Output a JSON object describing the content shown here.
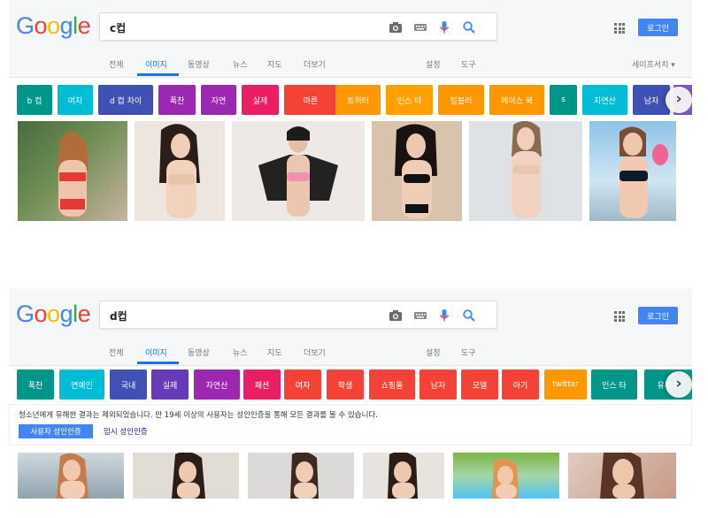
{
  "panels": [
    {
      "logo": [
        "G",
        "o",
        "o",
        "g",
        "l",
        "e"
      ],
      "query": "c컵",
      "login_label": "로그인",
      "tabs": [
        "전체",
        "이미지",
        "동영상",
        "뉴스",
        "지도",
        "더보기"
      ],
      "tools": [
        "설정",
        "도구"
      ],
      "safesearch": "세이프서치 ▾",
      "chips": [
        {
          "label": "b 컵",
          "color": "#009688"
        },
        {
          "label": "여자",
          "color": "#00bcd4"
        },
        {
          "label": "d 컵 차이",
          "color": "#3f51b5"
        },
        {
          "label": "폭찬",
          "color": "#9c27b0"
        },
        {
          "label": "자연",
          "color": "#9c27b0"
        },
        {
          "label": "실제",
          "color": "#e91e63"
        },
        {
          "label": "마른",
          "color": "#f44336"
        },
        {
          "label": "트위터",
          "color": "#ff9800"
        },
        {
          "label": "인스 타",
          "color": "#ffa000"
        },
        {
          "label": "텀블러",
          "color": "#ff9800"
        },
        {
          "label": "페이스 북",
          "color": "#ff9800"
        },
        {
          "label": "s",
          "color": "#009688"
        },
        {
          "label": "자연산",
          "color": "#00bcd4"
        },
        {
          "label": "남자",
          "color": "#3f51b5"
        }
      ],
      "next_icon": "›"
    },
    {
      "logo": [
        "G",
        "o",
        "o",
        "g",
        "l",
        "e"
      ],
      "query": "d컵",
      "login_label": "로그인",
      "tabs": [
        "전체",
        "이미지",
        "동영상",
        "뉴스",
        "지도",
        "더보기"
      ],
      "tools": [
        "설정",
        "도구"
      ],
      "chips": [
        {
          "label": "폭찬",
          "color": "#009688"
        },
        {
          "label": "연예인",
          "color": "#00bcd4"
        },
        {
          "label": "국내",
          "color": "#3f51b5"
        },
        {
          "label": "실제",
          "color": "#673ab7"
        },
        {
          "label": "자연산",
          "color": "#9c27b0"
        },
        {
          "label": "패션",
          "color": "#e91e63"
        },
        {
          "label": "여자",
          "color": "#f44336"
        },
        {
          "label": "학생",
          "color": "#f44336"
        },
        {
          "label": "쇼핑몰",
          "color": "#f44336"
        },
        {
          "label": "남자",
          "color": "#f44336"
        },
        {
          "label": "모델",
          "color": "#f44336"
        },
        {
          "label": "아기",
          "color": "#f44336"
        },
        {
          "label": "twitter",
          "color": "#ff9800"
        },
        {
          "label": "인스 타",
          "color": "#009688"
        },
        {
          "label": "유튜브",
          "color": "#009688"
        }
      ],
      "next_icon": "›",
      "notice": {
        "text": "청소년에게 유해한 결과는 제외되었습니다. 만 19세 이상의 사용자는 성인인증을 통해 모든 결과를 볼 수 있습니다.",
        "button": "사용자 성인인증",
        "link": "임시 성인인증"
      }
    }
  ],
  "colors": {
    "brand_blue": "#4285f4",
    "logo": [
      "#4285f4",
      "#ea4335",
      "#fbbc05",
      "#4285f4",
      "#34a853",
      "#ea4335"
    ]
  }
}
